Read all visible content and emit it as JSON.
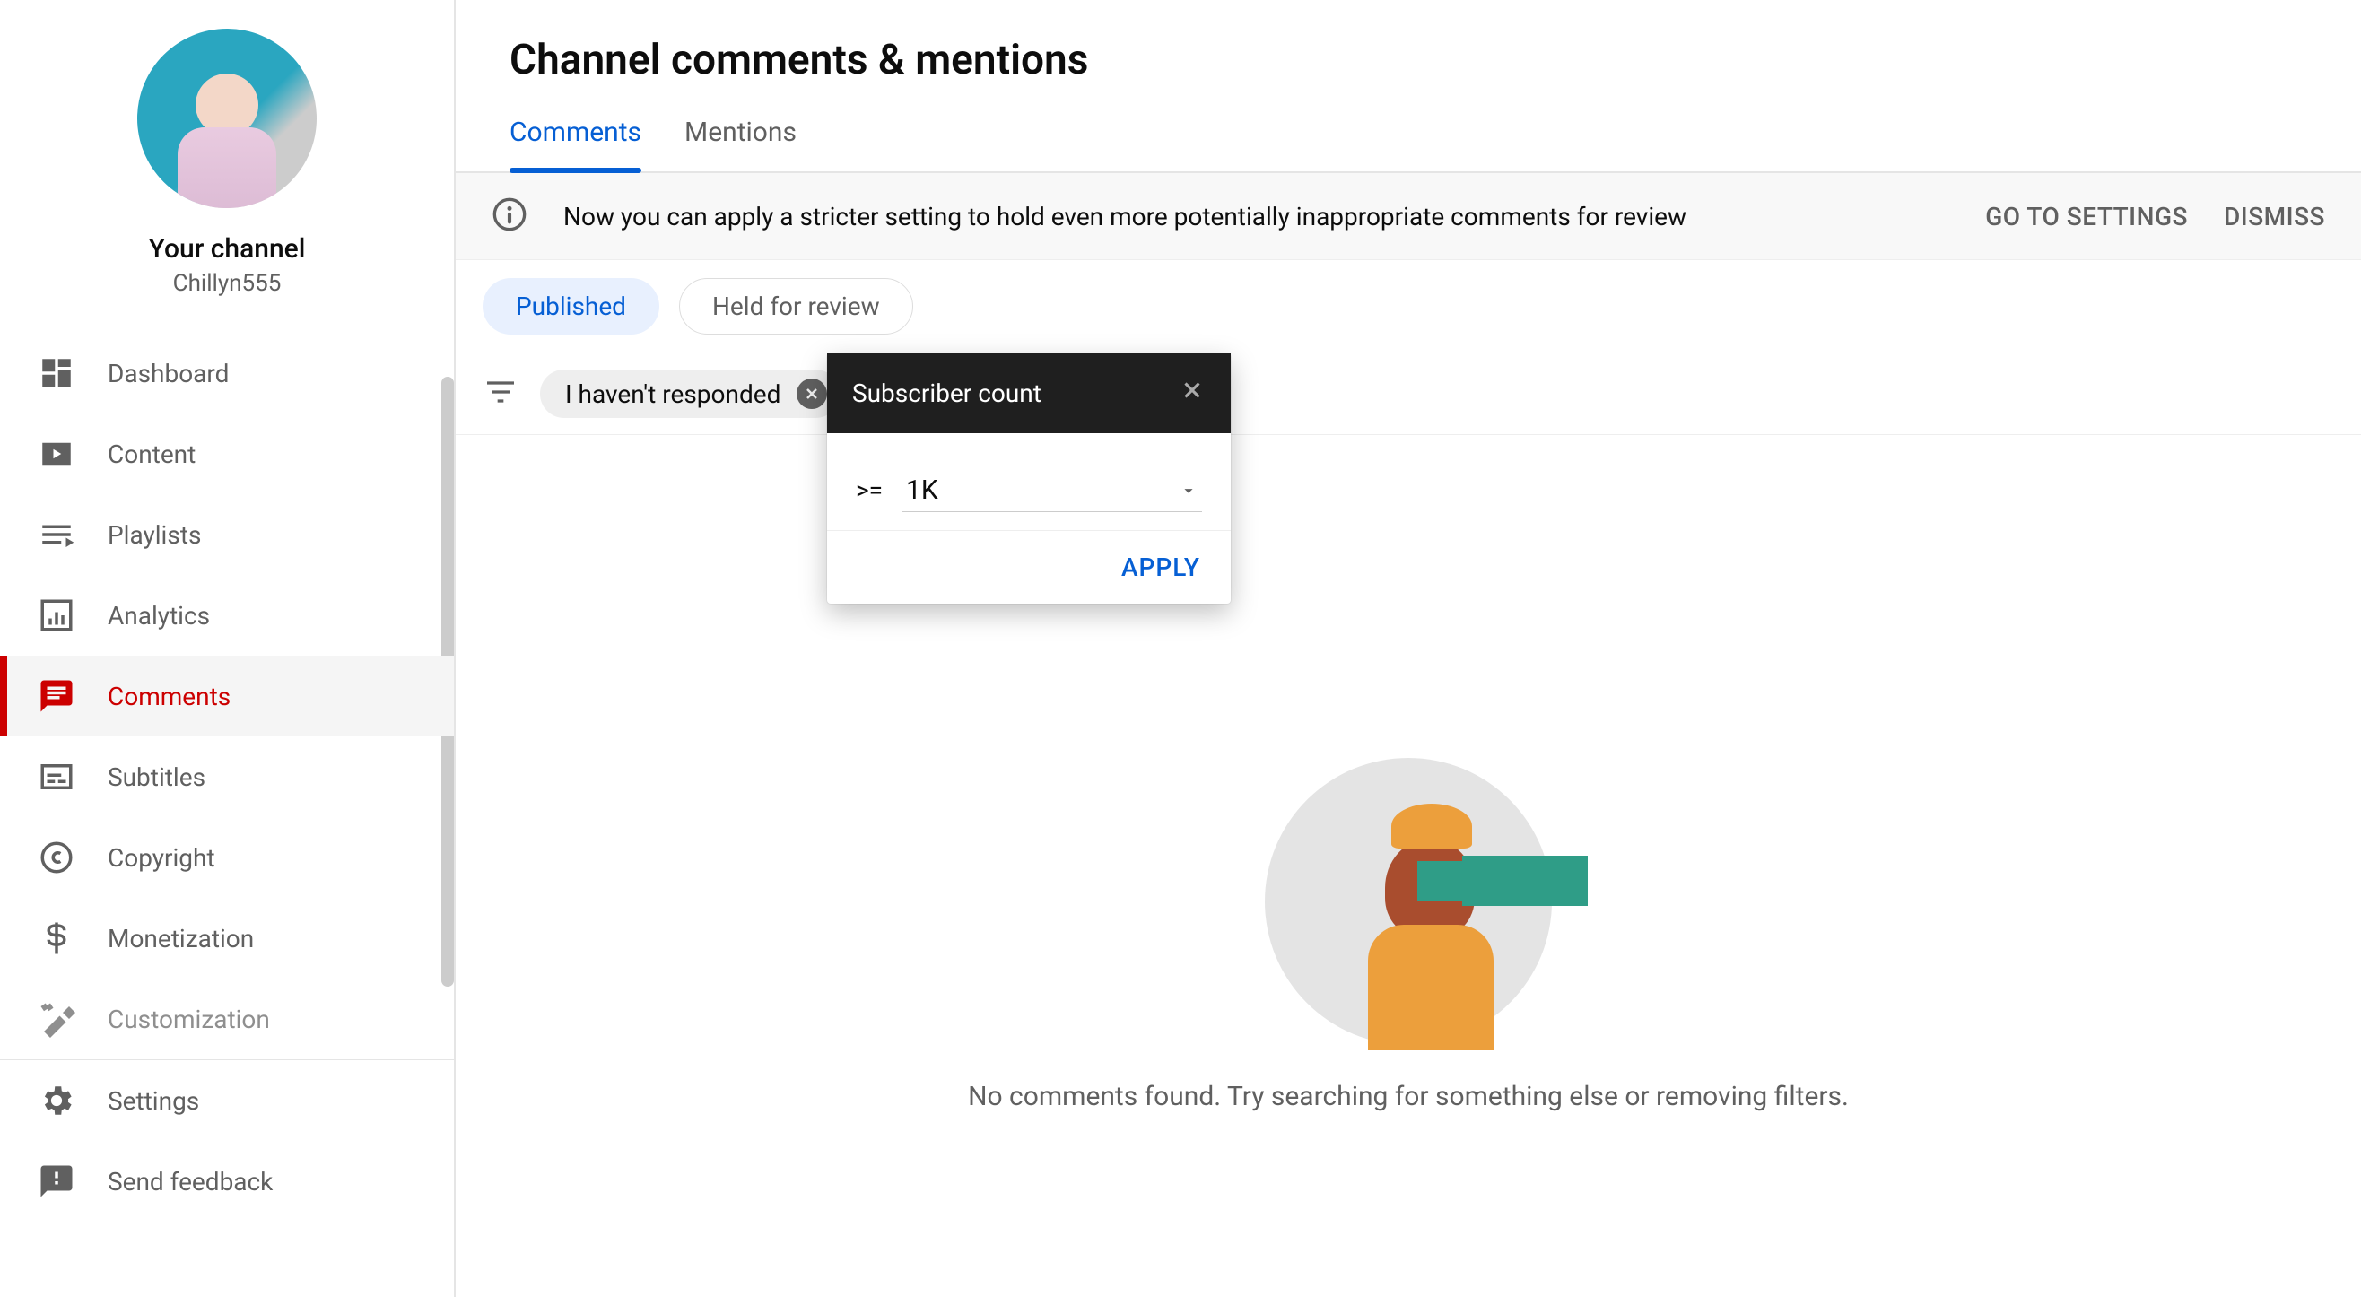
{
  "sidebar": {
    "your_channel_label": "Your channel",
    "channel_name": "Chillyn555",
    "items": [
      {
        "label": "Dashboard"
      },
      {
        "label": "Content"
      },
      {
        "label": "Playlists"
      },
      {
        "label": "Analytics"
      },
      {
        "label": "Comments"
      },
      {
        "label": "Subtitles"
      },
      {
        "label": "Copyright"
      },
      {
        "label": "Monetization"
      },
      {
        "label": "Customization"
      }
    ],
    "bottom": [
      {
        "label": "Settings"
      },
      {
        "label": "Send feedback"
      }
    ],
    "active_index": 4
  },
  "header": {
    "title": "Channel comments & mentions"
  },
  "tabs": {
    "items": [
      {
        "label": "Comments"
      },
      {
        "label": "Mentions"
      }
    ],
    "active_index": 0
  },
  "banner": {
    "text": "Now you can apply a stricter setting to hold even more potentially inappropriate comments for review",
    "go_to_settings": "GO TO SETTINGS",
    "dismiss": "DISMISS"
  },
  "status_chips": {
    "items": [
      {
        "label": "Published"
      },
      {
        "label": "Held for review"
      }
    ],
    "active_index": 0
  },
  "filters": {
    "applied": [
      {
        "label": "I haven't responded"
      }
    ]
  },
  "popover": {
    "title": "Subscriber count",
    "operator": ">=",
    "value": "1K",
    "apply_label": "APPLY"
  },
  "empty_state": {
    "message": "No comments found. Try searching for something else or removing filters."
  }
}
